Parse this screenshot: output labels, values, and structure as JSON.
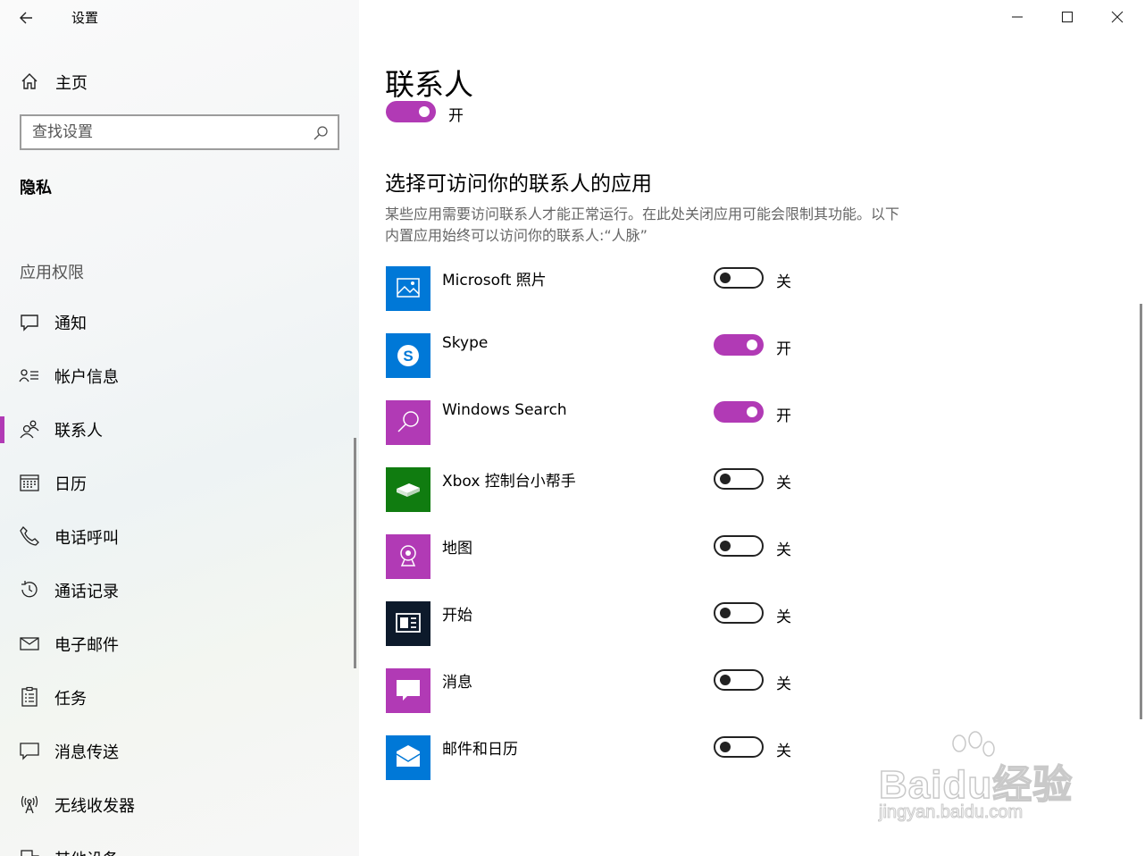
{
  "window": {
    "title": "设置",
    "controls": [
      "minimize-icon",
      "maximize-icon",
      "close-icon"
    ]
  },
  "sidebar": {
    "home_label": "主页",
    "search_placeholder": "查找设置",
    "section": "隐私",
    "group": "应用权限",
    "items": [
      {
        "label": "通知",
        "icon": "notification-icon"
      },
      {
        "label": "帐户信息",
        "icon": "account-info-icon"
      },
      {
        "label": "联系人",
        "icon": "contacts-icon",
        "selected": true
      },
      {
        "label": "日历",
        "icon": "calendar-icon"
      },
      {
        "label": "电话呼叫",
        "icon": "phone-icon"
      },
      {
        "label": "通话记录",
        "icon": "history-icon"
      },
      {
        "label": "电子邮件",
        "icon": "mail-icon"
      },
      {
        "label": "任务",
        "icon": "tasks-icon"
      },
      {
        "label": "消息传送",
        "icon": "messaging-icon"
      },
      {
        "label": "无线收发器",
        "icon": "radio-icon"
      },
      {
        "label": "其他设备",
        "icon": "devices-icon"
      }
    ]
  },
  "main": {
    "title": "联系人",
    "top_toggle": {
      "state": "开",
      "on": true
    },
    "subtitle": "选择可访问你的联系人的应用",
    "description": "某些应用需要访问联系人才能正常运行。在此处关闭应用可能会限制其功能。以下内置应用始终可以访问你的联系人:“人脉”",
    "apps": [
      {
        "name": "Microsoft 照片",
        "state": "关",
        "on": false,
        "tile_color": "#0078d7",
        "icon": "photos-icon"
      },
      {
        "name": "Skype",
        "state": "开",
        "on": true,
        "tile_color": "#0078d7",
        "icon": "skype-icon"
      },
      {
        "name": "Windows Search",
        "state": "开",
        "on": true,
        "tile_color": "#b13ab5",
        "icon": "search-icon"
      },
      {
        "name": "Xbox 控制台小帮手",
        "state": "关",
        "on": false,
        "tile_color": "#107c10",
        "icon": "xbox-icon"
      },
      {
        "name": "地图",
        "state": "关",
        "on": false,
        "tile_color": "#b13ab5",
        "icon": "maps-icon"
      },
      {
        "name": "开始",
        "state": "关",
        "on": false,
        "tile_color": "#0d1a2b",
        "icon": "start-icon"
      },
      {
        "name": "消息",
        "state": "关",
        "on": false,
        "tile_color": "#b13ab5",
        "icon": "messaging-icon"
      },
      {
        "name": "邮件和日历",
        "state": "关",
        "on": false,
        "tile_color": "#0078d7",
        "icon": "mail-icon"
      }
    ]
  },
  "watermark": {
    "brand": "Baidu经验",
    "url": "jingyan.baidu.com"
  },
  "colors": {
    "accent": "#b13ab5",
    "sidebar_bg": "#f5f6f6",
    "text": "#000000",
    "muted": "#666666"
  }
}
